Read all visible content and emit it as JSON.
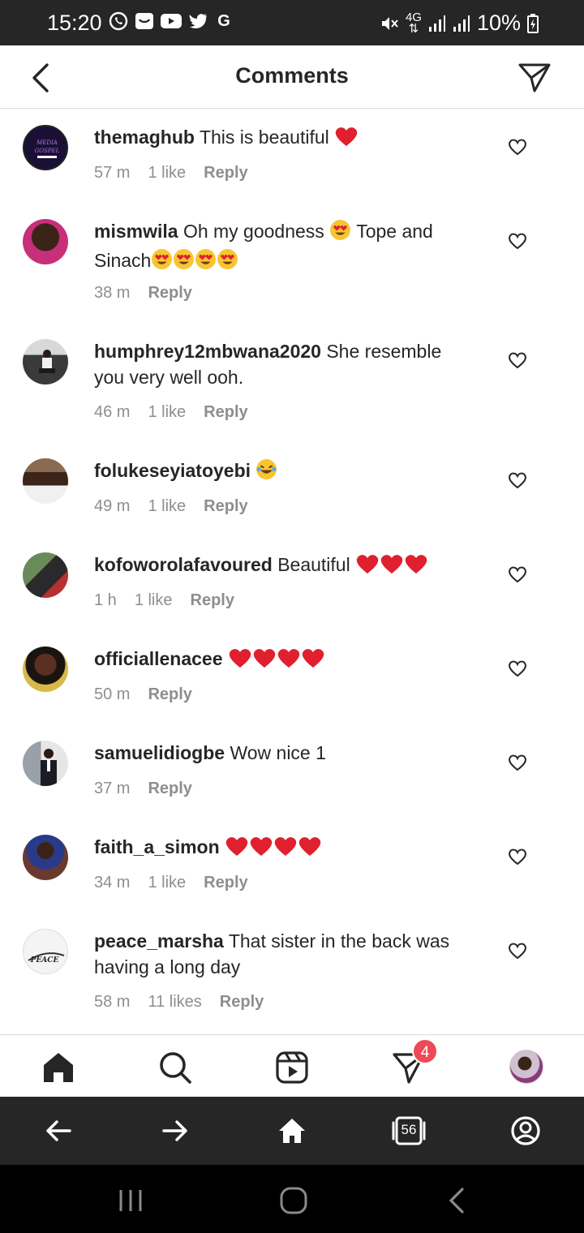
{
  "status_bar": {
    "time": "15:20",
    "network": "4G",
    "battery": "10%",
    "left_icons": [
      "whatsapp-icon",
      "message-icon",
      "youtube-icon",
      "twitter-icon",
      "google-icon"
    ],
    "right_icons": [
      "mute-icon",
      "data-arrows-icon",
      "signal-icon",
      "signal-icon",
      "battery-charging-icon"
    ]
  },
  "header": {
    "title": "Comments"
  },
  "comments": [
    {
      "username": "themaghub",
      "text": "This is beautiful",
      "emojis": [
        "heart"
      ],
      "time": "57 m",
      "likes": "1 like",
      "reply": "Reply",
      "avatar_color": "#1a1036"
    },
    {
      "username": "mismwila",
      "text": "Oh my goodness",
      "text2": "Tope and Sinach",
      "emojis": [
        "heart-eyes"
      ],
      "emojis2": [
        "heart-eyes",
        "heart-eyes",
        "heart-eyes",
        "heart-eyes"
      ],
      "time": "38 m",
      "likes": "",
      "reply": "Reply",
      "avatar_color": "#b03570"
    },
    {
      "username": "humphrey12mbwana2020",
      "text": "She resemble you very well ooh.",
      "time": "46 m",
      "likes": "1 like",
      "reply": "Reply",
      "avatar_color": "#4a4a4a"
    },
    {
      "username": "folukeseyiatoyebi",
      "text": "",
      "emojis": [
        "laugh"
      ],
      "time": "49 m",
      "likes": "1 like",
      "reply": "Reply",
      "avatar_color": "#5a4030"
    },
    {
      "username": "kofoworolafavoured",
      "text": "Beautiful",
      "emojis": [
        "heart",
        "heart",
        "heart"
      ],
      "time": "1 h",
      "likes": "1 like",
      "reply": "Reply",
      "avatar_color": "#3c5a3a"
    },
    {
      "username": "officiallenacee",
      "text": "",
      "emojis": [
        "heart",
        "heart",
        "heart",
        "heart"
      ],
      "time": "50 m",
      "likes": "",
      "reply": "Reply",
      "avatar_color": "#c8a040"
    },
    {
      "username": "samuelidiogbe",
      "text": "Wow nice 1",
      "time": "37 m",
      "likes": "",
      "reply": "Reply",
      "avatar_color": "#5a5a60"
    },
    {
      "username": "faith_a_simon",
      "text": "",
      "emojis": [
        "heart",
        "heart",
        "heart",
        "heart"
      ],
      "time": "34 m",
      "likes": "1 like",
      "reply": "Reply",
      "avatar_color": "#4a2a40"
    },
    {
      "username": "peace_marsha",
      "text": "That sister in the back was having a long day",
      "time": "58 m",
      "likes": "11 likes",
      "reply": "Reply",
      "avatar_color": "#f2f2f2"
    }
  ],
  "avatar_labels": {
    "themaghub": "MEDIA GOSPEL",
    "peace_marsha": "PEACE"
  },
  "bottom_nav": {
    "items": [
      "home-icon",
      "search-icon",
      "reels-icon",
      "direct-icon",
      "profile-avatar"
    ],
    "direct_badge": "4"
  },
  "browser_bar": {
    "items": [
      "back-arrow-icon",
      "forward-arrow-icon",
      "home-icon",
      "tabs-icon",
      "account-icon"
    ],
    "tabs_count": "56"
  },
  "system_nav": {
    "items": [
      "recents-icon",
      "home-pill-icon",
      "back-chevron-icon"
    ]
  },
  "colors": {
    "status_bar": "#262626",
    "text_primary": "#262626",
    "text_secondary": "#8e8e8e",
    "badge": "#ed4956",
    "divider": "#dbdbdb"
  }
}
